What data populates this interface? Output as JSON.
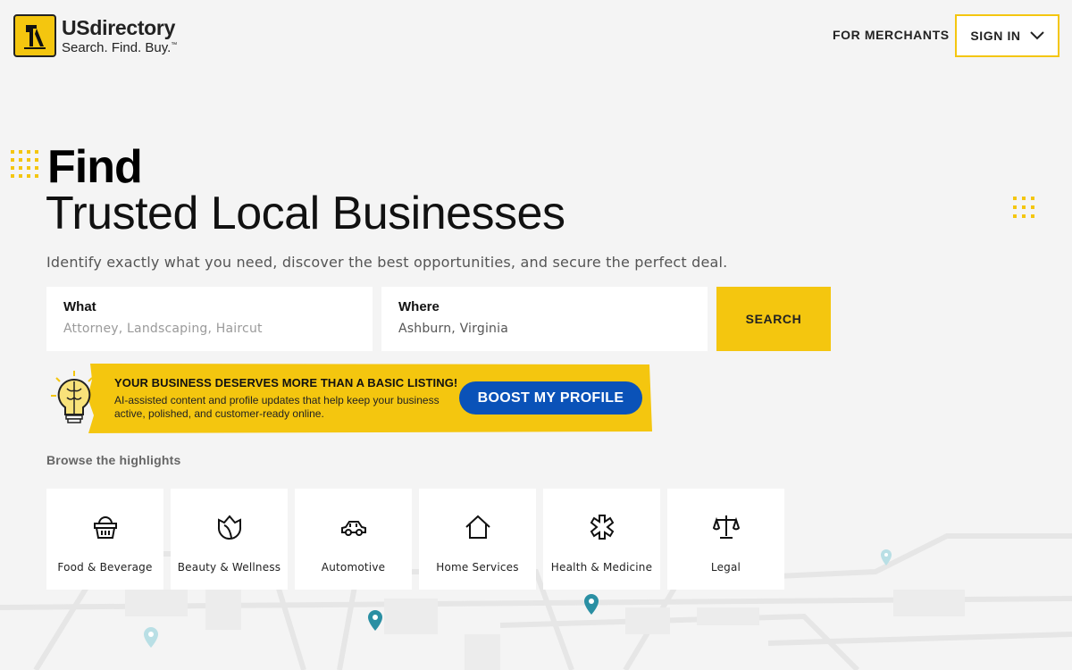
{
  "header": {
    "brand_name": "USdirectory",
    "brand_tagline": "Search. Find. Buy.",
    "brand_tm": "™",
    "for_merchants": "FOR MERCHANTS",
    "sign_in": "SIGN IN"
  },
  "hero": {
    "find": "Find",
    "title": "Trusted Local Businesses",
    "subtitle": "Identify exactly what you need, discover the best opportunities, and secure the perfect deal."
  },
  "search": {
    "what_label": "What",
    "what_placeholder": "Attorney, Landscaping, Haircut",
    "where_label": "Where",
    "where_value": "Ashburn, Virginia",
    "button": "SEARCH"
  },
  "banner": {
    "heading": "YOUR BUSINESS DESERVES MORE THAN A BASIC LISTING!",
    "body": "AI-assisted content and profile updates that help keep your business active, polished, and customer-ready online.",
    "button": "BOOST MY PROFILE"
  },
  "browse": {
    "title": "Browse the highlights",
    "categories": [
      {
        "label": "Food & Beverage",
        "icon": "basket-icon"
      },
      {
        "label": "Beauty & Wellness",
        "icon": "lotus-icon"
      },
      {
        "label": "Automotive",
        "icon": "car-icon"
      },
      {
        "label": "Home Services",
        "icon": "house-icon"
      },
      {
        "label": "Health & Medicine",
        "icon": "medical-cross-icon"
      },
      {
        "label": "Legal",
        "icon": "scales-icon"
      }
    ]
  },
  "colors": {
    "accent": "#f4c60f",
    "button_blue": "#0a52b8",
    "background": "#f4f4f4",
    "map_pin": "#2a8fa3"
  }
}
